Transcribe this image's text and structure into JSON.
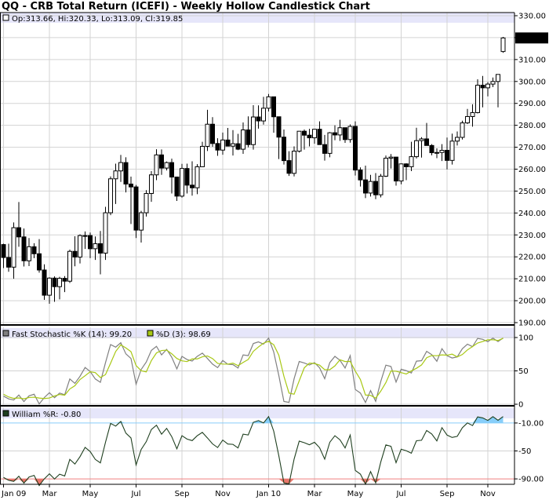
{
  "title": "QQ - CRB Total Return (ICEFI) - Weekly Hollow Candlestick Chart",
  "colors": {
    "background": "#ffffff",
    "header_band": "#e6e6fa",
    "grid": "#d3d3d3",
    "stochastic_k": "#808080",
    "stochastic_d": "#a8c814",
    "williams": "#1f3f1f",
    "overbought_fill": "#87cefa",
    "oversold_fill": "#e8776b",
    "level_line_high": "#87cefa",
    "level_line_low": "#f08080"
  },
  "legend": {
    "ohlc": "Op:313.66, Hi:320.33, Lo:313.09, Cl:319.85",
    "stoch_k": "Fast Stochastic %K (14): 99.20",
    "stoch_d": "%D (3): 98.69",
    "williams": "William %R: -0.80"
  },
  "last_price_label": "319.85",
  "chart_data": [
    {
      "type": "candlestick",
      "style": "hollow",
      "frequency": "weekly",
      "title": "QQ - CRB Total Return (ICEFI) - Weekly Hollow Candlestick Chart",
      "ylim": [
        190,
        330
      ],
      "y_ticks": [
        "190.00",
        "200.00",
        "210.00",
        "220.00",
        "230.00",
        "240.00",
        "250.00",
        "260.00",
        "270.00",
        "280.00",
        "290.00",
        "300.00",
        "310.00",
        "320.00",
        "330.00"
      ],
      "x_tick_labels": [
        "Jan 09",
        "Mar",
        "May",
        "Jul",
        "Sep",
        "Nov",
        "Jan 10",
        "Mar",
        "May",
        "Jul",
        "Sep",
        "Nov"
      ],
      "x_tick_weeks": [
        0,
        9,
        17,
        26,
        35,
        43,
        52,
        61,
        69,
        78,
        87,
        95
      ],
      "grid": true,
      "ohlc": [
        [
          225.6,
          226.0,
          214.9,
          219.7
        ],
        [
          219.7,
          226.0,
          213.2,
          215.3
        ],
        [
          215.3,
          235.7,
          210.0,
          233.3
        ],
        [
          233.3,
          245.0,
          224.6,
          229.1
        ],
        [
          229.1,
          232.9,
          215.6,
          218.2
        ],
        [
          218.2,
          228.6,
          215.8,
          224.6
        ],
        [
          224.6,
          226.2,
          219.4,
          221.4
        ],
        [
          221.4,
          228.1,
          212.8,
          214.0
        ],
        [
          214.0,
          216.6,
          200.4,
          202.5
        ],
        [
          202.5,
          210.7,
          198.6,
          210.3
        ],
        [
          210.3,
          211.1,
          199.5,
          206.4
        ],
        [
          206.4,
          210.9,
          200.6,
          210.2
        ],
        [
          210.2,
          211.2,
          203.9,
          208.9
        ],
        [
          208.9,
          223.3,
          208.1,
          222.5
        ],
        [
          222.5,
          229.4,
          215.7,
          219.9
        ],
        [
          219.9,
          230.3,
          217.0,
          229.7
        ],
        [
          229.7,
          231.6,
          223.6,
          229.7
        ],
        [
          229.7,
          231.1,
          219.4,
          223.7
        ],
        [
          223.7,
          229.3,
          218.6,
          226.0
        ],
        [
          226.0,
          231.8,
          212.0,
          221.7
        ],
        [
          221.7,
          242.8,
          218.6,
          240.1
        ],
        [
          240.1,
          256.7,
          239.0,
          255.6
        ],
        [
          255.6,
          262.5,
          244.1,
          259.2
        ],
        [
          259.2,
          266.5,
          254.2,
          263.0
        ],
        [
          263.0,
          265.4,
          249.4,
          253.2
        ],
        [
          253.2,
          256.6,
          235.0,
          251.9
        ],
        [
          251.9,
          252.8,
          228.6,
          232.2
        ],
        [
          232.2,
          241.0,
          226.5,
          240.1
        ],
        [
          240.1,
          250.4,
          238.4,
          248.9
        ],
        [
          248.9,
          259.1,
          245.1,
          257.4
        ],
        [
          257.4,
          269.1,
          255.0,
          266.5
        ],
        [
          266.5,
          269.0,
          257.4,
          260.5
        ],
        [
          260.5,
          263.5,
          259.4,
          263.0
        ],
        [
          263.0,
          264.8,
          248.9,
          256.4
        ],
        [
          256.4,
          256.6,
          245.5,
          247.7
        ],
        [
          247.7,
          262.4,
          247.0,
          260.3
        ],
        [
          260.3,
          262.5,
          248.9,
          252.7
        ],
        [
          252.7,
          263.6,
          247.9,
          251.5
        ],
        [
          251.5,
          262.3,
          248.6,
          261.1
        ],
        [
          261.1,
          272.5,
          260.9,
          270.4
        ],
        [
          270.4,
          287.1,
          268.3,
          280.5
        ],
        [
          280.5,
          283.7,
          270.2,
          271.7
        ],
        [
          271.7,
          274.1,
          266.1,
          268.7
        ],
        [
          268.7,
          276.7,
          266.6,
          273.3
        ],
        [
          273.3,
          278.8,
          272.3,
          270.5
        ],
        [
          270.5,
          277.8,
          266.2,
          271.6
        ],
        [
          271.6,
          276.1,
          268.7,
          269.1
        ],
        [
          269.1,
          281.3,
          267.0,
          277.9
        ],
        [
          277.9,
          284.1,
          270.0,
          271.2
        ],
        [
          271.2,
          289.2,
          268.9,
          283.8
        ],
        [
          283.8,
          289.1,
          278.5,
          282.0
        ],
        [
          282.0,
          293.0,
          280.3,
          287.8
        ],
        [
          287.8,
          294.3,
          286.3,
          293.0
        ],
        [
          293.0,
          291.4,
          276.6,
          283.9
        ],
        [
          283.9,
          283.6,
          264.6,
          274.6
        ],
        [
          274.6,
          278.1,
          262.1,
          263.9
        ],
        [
          263.9,
          268.2,
          256.9,
          258.1
        ],
        [
          258.1,
          270.4,
          256.7,
          268.2
        ],
        [
          268.2,
          277.3,
          267.6,
          277.3
        ],
        [
          277.3,
          278.1,
          268.9,
          275.5
        ],
        [
          275.5,
          278.4,
          270.4,
          274.3
        ],
        [
          274.3,
          277.4,
          271.6,
          278.2
        ],
        [
          278.2,
          281.8,
          274.4,
          271.2
        ],
        [
          271.2,
          275.6,
          263.9,
          267.2
        ],
        [
          267.2,
          276.9,
          265.4,
          276.6
        ],
        [
          276.6,
          280.0,
          273.2,
          275.6
        ],
        [
          275.6,
          282.5,
          272.9,
          278.9
        ],
        [
          278.9,
          277.7,
          272.0,
          273.5
        ],
        [
          273.5,
          280.4,
          272.1,
          279.5
        ],
        [
          279.5,
          281.8,
          257.1,
          259.6
        ],
        [
          259.6,
          260.8,
          252.1,
          255.1
        ],
        [
          255.1,
          261.6,
          246.8,
          249.1
        ],
        [
          249.1,
          257.4,
          247.5,
          254.4
        ],
        [
          254.4,
          258.2,
          246.3,
          248.3
        ],
        [
          248.3,
          257.8,
          247.1,
          256.8
        ],
        [
          256.8,
          266.2,
          256.4,
          265.0
        ],
        [
          265.0,
          266.9,
          260.3,
          265.5
        ],
        [
          265.5,
          265.6,
          252.5,
          254.6
        ],
        [
          254.6,
          262.6,
          253.1,
          262.4
        ],
        [
          262.4,
          262.7,
          255.0,
          261.1
        ],
        [
          261.1,
          272.5,
          259.1,
          265.7
        ],
        [
          265.7,
          278.9,
          264.9,
          273.0
        ],
        [
          273.0,
          274.6,
          265.3,
          273.8
        ],
        [
          273.8,
          281.1,
          273.1,
          270.8
        ],
        [
          270.8,
          271.4,
          266.3,
          267.5
        ],
        [
          267.5,
          269.5,
          265.0,
          267.6
        ],
        [
          267.6,
          271.4,
          263.7,
          268.6
        ],
        [
          268.6,
          274.4,
          259.9,
          264.0
        ],
        [
          264.0,
          276.2,
          262.1,
          272.8
        ],
        [
          272.8,
          277.2,
          270.8,
          274.5
        ],
        [
          274.5,
          282.1,
          273.5,
          281.1
        ],
        [
          281.1,
          287.5,
          280.6,
          284.0
        ],
        [
          284.0,
          289.6,
          279.4,
          285.8
        ],
        [
          285.8,
          301.0,
          285.4,
          298.3
        ],
        [
          298.3,
          302.5,
          288.2,
          297.1
        ],
        [
          297.1,
          299.7,
          293.2,
          298.8
        ],
        [
          298.8,
          301.8,
          297.4,
          300.0
        ],
        [
          300.0,
          301.4,
          288.2,
          303.2
        ],
        [
          313.66,
          320.33,
          313.09,
          319.85
        ]
      ]
    },
    {
      "type": "line",
      "title": "Fast Stochastic %K (14) / %D (3)",
      "ylim": [
        0,
        100
      ],
      "y_ticks": [
        "0",
        "50",
        "100"
      ],
      "series": [
        {
          "name": "Fast Stochastic %K (14)",
          "values": [
            12.1,
            8.0,
            6.4,
            13.8,
            4.0,
            12.6,
            15.0,
            0.4,
            10.0,
            17.3,
            9.8,
            16.7,
            14.2,
            37.9,
            31.3,
            41.8,
            55.1,
            49.1,
            37.9,
            32.9,
            62.3,
            89.4,
            85.6,
            92.2,
            75.5,
            68.6,
            30.0,
            52.1,
            63.3,
            80.7,
            86.8,
            74.0,
            82.3,
            70.4,
            53.0,
            71.8,
            67.0,
            64.8,
            71.8,
            76.6,
            68.6,
            60.1,
            54.9,
            65.6,
            59.9,
            59.4,
            54.3,
            74.0,
            72.9,
            91.0,
            93.5,
            90.1,
            99.2,
            78.4,
            43.1,
            4.2,
            2.8,
            38.3,
            64.1,
            61.8,
            58.8,
            62.4,
            54.6,
            38.3,
            62.4,
            71.8,
            65.9,
            54.3,
            72.8,
            22.1,
            16.8,
            2.6,
            20.5,
            4.3,
            34.2,
            58.6,
            56.6,
            33.2,
            52.5,
            50.3,
            46.8,
            64.6,
            65.3,
            79.3,
            74.3,
            64.4,
            83.3,
            72.7,
            69.3,
            70.9,
            83.2,
            90.1,
            86.3,
            98.7,
            97.3,
            93.7,
            99.1,
            93.9,
            99.2
          ]
        },
        {
          "name": "%D (3)",
          "values": [
            15.0,
            10.9,
            8.8,
            9.4,
            8.1,
            10.1,
            10.5,
            9.3,
            8.5,
            9.3,
            12.4,
            14.6,
            13.6,
            22.9,
            27.8,
            37.0,
            42.7,
            48.7,
            47.4,
            40.0,
            44.4,
            61.5,
            79.1,
            89.1,
            84.4,
            78.8,
            58.0,
            50.2,
            48.5,
            65.4,
            76.9,
            80.5,
            81.1,
            75.6,
            68.6,
            65.1,
            63.9,
            67.9,
            67.9,
            71.1,
            72.4,
            68.4,
            61.2,
            60.2,
            60.1,
            61.6,
            57.9,
            62.6,
            67.1,
            79.3,
            85.8,
            91.5,
            94.3,
            89.2,
            73.6,
            41.9,
            16.7,
            15.1,
            35.1,
            54.7,
            61.6,
            61.0,
            58.6,
            51.8,
            51.8,
            57.5,
            66.7,
            64.0,
            64.3,
            49.7,
            37.2,
            13.8,
            13.3,
            9.1,
            19.7,
            32.4,
            49.8,
            49.5,
            47.4,
            45.3,
            49.9,
            53.9,
            58.9,
            69.7,
            73.0,
            72.7,
            74.0,
            73.5,
            75.1,
            71.0,
            74.5,
            81.4,
            86.5,
            91.7,
            94.1,
            96.6,
            96.7,
            95.6,
            98.69
          ]
        }
      ]
    },
    {
      "type": "line",
      "title": "William %R",
      "ylim": [
        -100,
        0
      ],
      "y_ticks": [
        "-10.00",
        "-50",
        "-90.00"
      ],
      "levels": [
        -10,
        -90
      ],
      "series": [
        {
          "name": "William %R",
          "values": [
            -87.9,
            -92.0,
            -93.6,
            -86.2,
            -96.0,
            -87.4,
            -85.0,
            -99.6,
            -90.0,
            -82.7,
            -90.2,
            -83.3,
            -85.8,
            -62.1,
            -68.7,
            -58.2,
            -44.9,
            -50.9,
            -62.1,
            -67.1,
            -37.7,
            -10.6,
            -14.4,
            -7.8,
            -24.5,
            -31.4,
            -70.0,
            -47.9,
            -36.7,
            -19.3,
            -13.2,
            -26.0,
            -17.7,
            -29.6,
            -47.0,
            -28.2,
            -33.0,
            -35.2,
            -28.2,
            -23.4,
            -31.4,
            -39.9,
            -45.1,
            -34.4,
            -40.1,
            -40.6,
            -45.7,
            -26.0,
            -27.1,
            -9.0,
            -6.5,
            -9.9,
            -0.8,
            -21.6,
            -56.9,
            -95.8,
            -97.2,
            -61.7,
            -35.9,
            -38.2,
            -41.2,
            -37.6,
            -45.4,
            -61.7,
            -37.6,
            -28.2,
            -34.1,
            -45.7,
            -27.2,
            -77.9,
            -83.2,
            -97.4,
            -79.5,
            -95.7,
            -65.8,
            -41.4,
            -43.4,
            -66.8,
            -47.5,
            -49.7,
            -53.2,
            -35.4,
            -34.7,
            -20.7,
            -25.7,
            -35.6,
            -16.7,
            -27.3,
            -30.7,
            -29.1,
            -16.8,
            -9.9,
            -13.7,
            -1.3,
            -2.7,
            -6.3,
            -0.9,
            -6.1,
            -0.8
          ]
        }
      ]
    }
  ]
}
